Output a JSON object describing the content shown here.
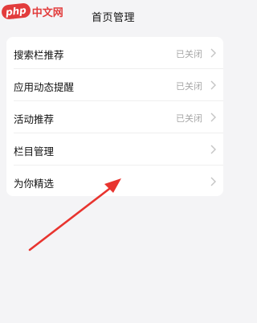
{
  "header": {
    "title": "首页管理",
    "logo_badge": "php",
    "logo_text": "中文网"
  },
  "settings": {
    "items": [
      {
        "label": "搜索栏推荐",
        "status": "已关闭"
      },
      {
        "label": "应用动态提醒",
        "status": "已关闭"
      },
      {
        "label": "活动推荐",
        "status": "已关闭"
      },
      {
        "label": "栏目管理",
        "status": ""
      },
      {
        "label": "为你精选",
        "status": ""
      }
    ]
  },
  "colors": {
    "background": "#f4f4f6",
    "card": "#ffffff",
    "annotation_arrow": "#e8342f",
    "status_text": "#a7a7a7",
    "logo": "#e23c3c"
  },
  "icons": {
    "back": "chevron-left-icon",
    "row_chevron": "chevron-right-icon"
  }
}
